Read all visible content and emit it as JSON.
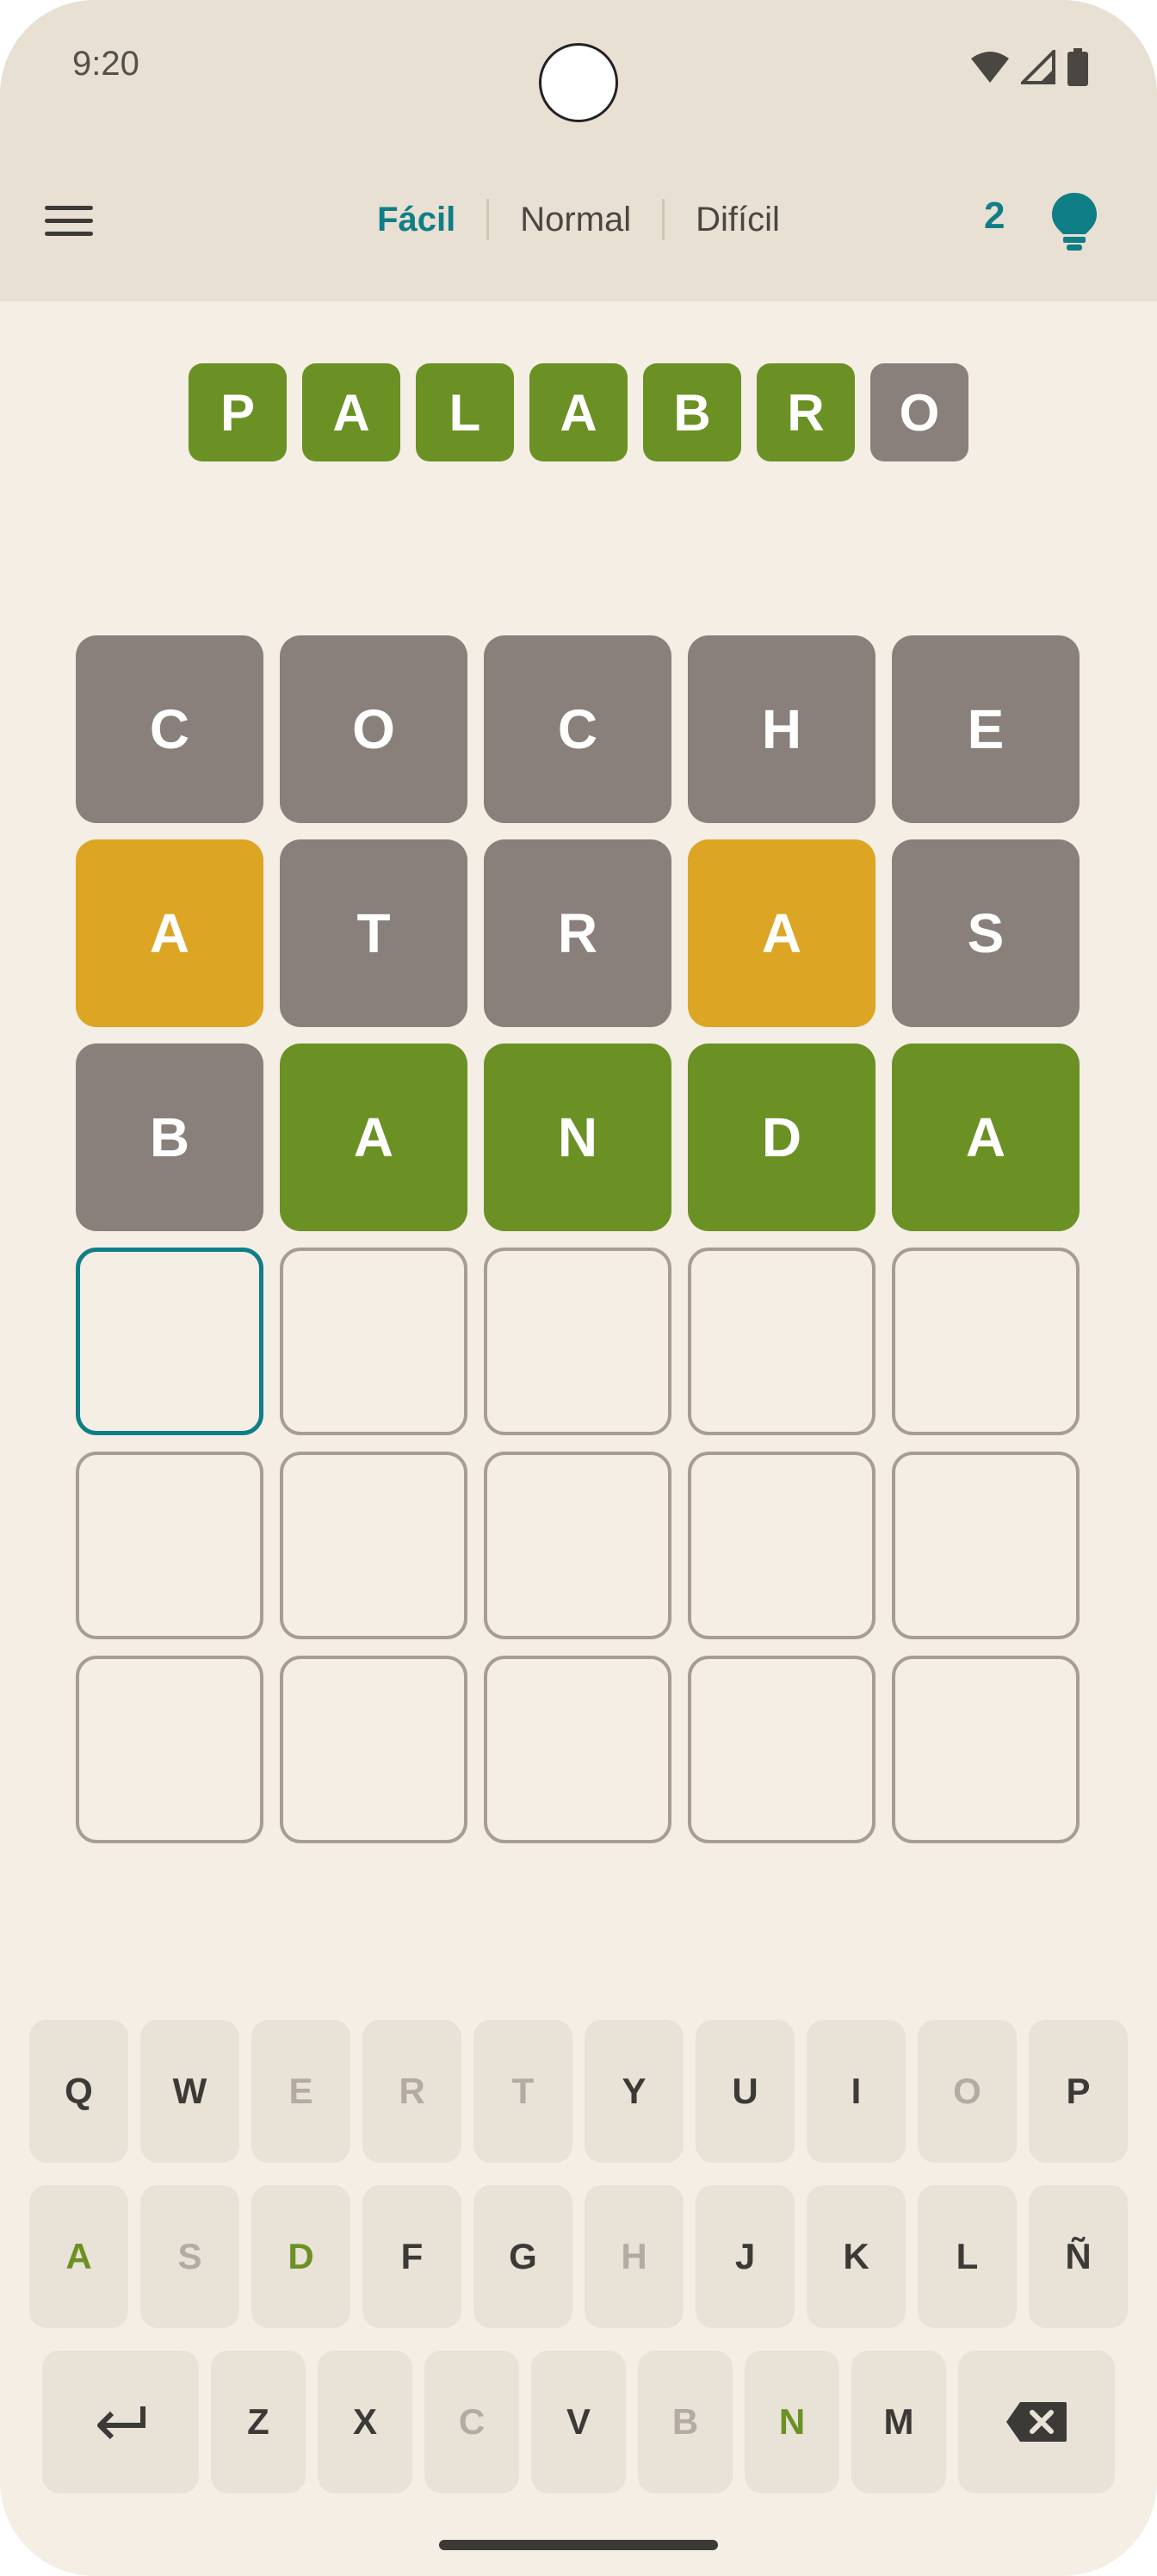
{
  "status_bar": {
    "time": "9:20"
  },
  "header": {
    "tabs": [
      {
        "label": "Fácil",
        "active": true
      },
      {
        "label": "Normal",
        "active": false
      },
      {
        "label": "Difícil",
        "active": false
      }
    ],
    "hint_count": "2",
    "menu_icon": "hamburger-menu-icon",
    "hint_icon": "lightbulb-icon"
  },
  "colors": {
    "correct": "#6b9124",
    "present": "#dca523",
    "absent": "#8a807b",
    "accent": "#0f7e86"
  },
  "title_tiles": [
    {
      "letter": "P",
      "state": "correct"
    },
    {
      "letter": "A",
      "state": "correct"
    },
    {
      "letter": "L",
      "state": "correct"
    },
    {
      "letter": "A",
      "state": "correct"
    },
    {
      "letter": "B",
      "state": "correct"
    },
    {
      "letter": "R",
      "state": "correct"
    },
    {
      "letter": "O",
      "state": "absent"
    }
  ],
  "board": {
    "rows": [
      [
        {
          "letter": "C",
          "state": "absent"
        },
        {
          "letter": "O",
          "state": "absent"
        },
        {
          "letter": "C",
          "state": "absent"
        },
        {
          "letter": "H",
          "state": "absent"
        },
        {
          "letter": "E",
          "state": "absent"
        }
      ],
      [
        {
          "letter": "A",
          "state": "present"
        },
        {
          "letter": "T",
          "state": "absent"
        },
        {
          "letter": "R",
          "state": "absent"
        },
        {
          "letter": "A",
          "state": "present"
        },
        {
          "letter": "S",
          "state": "absent"
        }
      ],
      [
        {
          "letter": "B",
          "state": "absent"
        },
        {
          "letter": "A",
          "state": "correct"
        },
        {
          "letter": "N",
          "state": "correct"
        },
        {
          "letter": "D",
          "state": "correct"
        },
        {
          "letter": "A",
          "state": "correct"
        }
      ],
      [
        {
          "letter": "",
          "state": "active"
        },
        {
          "letter": "",
          "state": "empty"
        },
        {
          "letter": "",
          "state": "empty"
        },
        {
          "letter": "",
          "state": "empty"
        },
        {
          "letter": "",
          "state": "empty"
        }
      ],
      [
        {
          "letter": "",
          "state": "empty"
        },
        {
          "letter": "",
          "state": "empty"
        },
        {
          "letter": "",
          "state": "empty"
        },
        {
          "letter": "",
          "state": "empty"
        },
        {
          "letter": "",
          "state": "empty"
        }
      ],
      [
        {
          "letter": "",
          "state": "empty"
        },
        {
          "letter": "",
          "state": "empty"
        },
        {
          "letter": "",
          "state": "empty"
        },
        {
          "letter": "",
          "state": "empty"
        },
        {
          "letter": "",
          "state": "empty"
        }
      ]
    ]
  },
  "keyboard": {
    "rows": [
      [
        {
          "k": "Q",
          "s": "normal"
        },
        {
          "k": "W",
          "s": "normal"
        },
        {
          "k": "E",
          "s": "absent"
        },
        {
          "k": "R",
          "s": "absent"
        },
        {
          "k": "T",
          "s": "absent"
        },
        {
          "k": "Y",
          "s": "normal"
        },
        {
          "k": "U",
          "s": "normal"
        },
        {
          "k": "I",
          "s": "normal"
        },
        {
          "k": "O",
          "s": "absent"
        },
        {
          "k": "P",
          "s": "normal"
        }
      ],
      [
        {
          "k": "A",
          "s": "correct"
        },
        {
          "k": "S",
          "s": "absent"
        },
        {
          "k": "D",
          "s": "correct"
        },
        {
          "k": "F",
          "s": "normal"
        },
        {
          "k": "G",
          "s": "normal"
        },
        {
          "k": "H",
          "s": "absent"
        },
        {
          "k": "J",
          "s": "normal"
        },
        {
          "k": "K",
          "s": "normal"
        },
        {
          "k": "L",
          "s": "normal"
        },
        {
          "k": "Ñ",
          "s": "normal"
        }
      ],
      [
        {
          "k": "Z",
          "s": "normal"
        },
        {
          "k": "X",
          "s": "normal"
        },
        {
          "k": "C",
          "s": "absent"
        },
        {
          "k": "V",
          "s": "normal"
        },
        {
          "k": "B",
          "s": "absent"
        },
        {
          "k": "N",
          "s": "correct"
        },
        {
          "k": "M",
          "s": "normal"
        }
      ]
    ],
    "enter_icon": "enter-icon",
    "backspace_icon": "backspace-icon",
    "key_colors": {
      "normal": "#3c3a37",
      "absent": "#b4aca3",
      "correct": "#6b9124"
    }
  }
}
